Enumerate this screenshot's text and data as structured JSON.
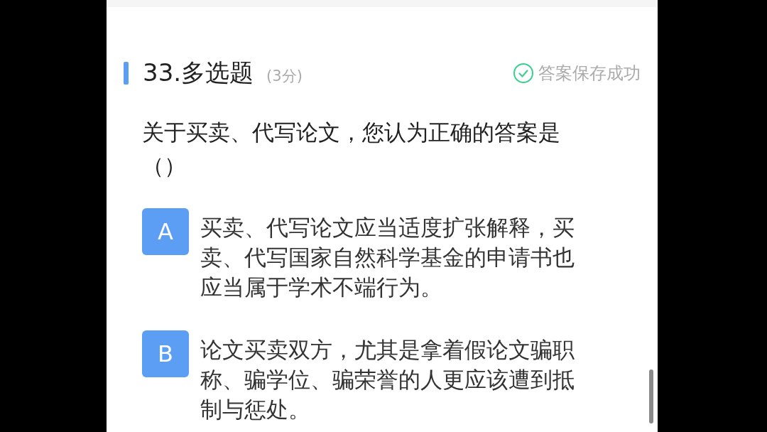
{
  "question": {
    "title": "33.多选题",
    "score": "(3分)",
    "status": "答案保存成功",
    "text": "关于买卖、代写论文，您认为正确的答案是（）"
  },
  "options": [
    {
      "letter": "A",
      "text": "买卖、代写论文应当适度扩张解释，买卖、代写国家自然科学基金的申请书也应当属于学术不端行为。"
    },
    {
      "letter": "B",
      "text": "论文买卖双方，尤其是拿着假论文骗职称、骗学位、骗荣誉的人更应该遭到抵制与惩处。"
    }
  ]
}
